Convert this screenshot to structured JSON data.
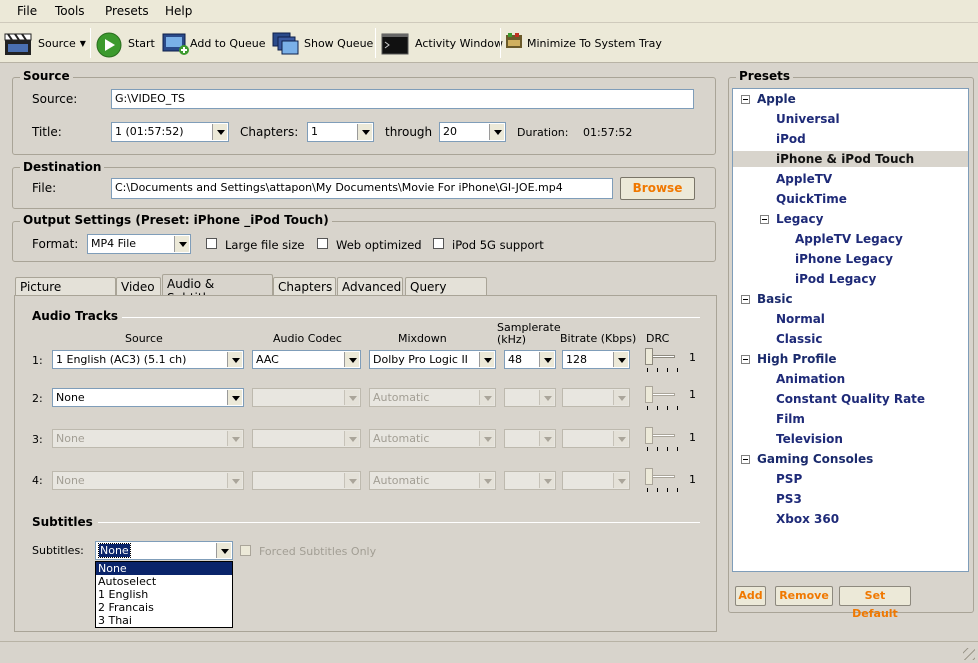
{
  "menu": {
    "file": "File",
    "tools": "Tools",
    "presets": "Presets",
    "help": "Help"
  },
  "toolbar": {
    "source": "Source",
    "start": "Start",
    "add_to_queue": "Add to Queue",
    "show_queue": "Show Queue",
    "activity_window": "Activity Window",
    "minimize": "Minimize To System Tray"
  },
  "source": {
    "group_title": "Source",
    "source_label": "Source:",
    "source_value": "G:\\VIDEO_TS",
    "title_label": "Title:",
    "title_value": "1 (01:57:52)",
    "chapters_label": "Chapters:",
    "chapters_from": "1",
    "through_label": "through",
    "chapters_to": "20",
    "duration_label": "Duration:",
    "duration_value": "01:57:52"
  },
  "destination": {
    "group_title": "Destination",
    "file_label": "File:",
    "file_value": "C:\\Documents and Settings\\attapon\\My Documents\\Movie For iPhone\\GI-JOE.mp4",
    "browse": "Browse"
  },
  "output": {
    "group_title": "Output Settings (Preset: iPhone _iPod Touch)",
    "format_label": "Format:",
    "format_value": "MP4 File",
    "large_file": "Large file size",
    "web_optimized": "Web optimized",
    "ipod5g": "iPod 5G support"
  },
  "tabs": [
    "Picture Settings",
    "Video",
    "Audio & Subtitles",
    "Chapters",
    "Advanced",
    "Query Editor"
  ],
  "audio": {
    "section_title": "Audio Tracks",
    "headers": {
      "source": "Source",
      "codec": "Audio Codec",
      "mixdown": "Mixdown",
      "samplerate_1": "Samplerate",
      "samplerate_2": "(kHz)",
      "bitrate": "Bitrate (Kbps)",
      "drc": "DRC"
    },
    "tracks": [
      {
        "num": "1:",
        "source": "1 English (AC3) (5.1 ch)",
        "codec": "AAC",
        "mixdown": "Dolby Pro Logic II",
        "samplerate": "48",
        "bitrate": "128",
        "drc": "1"
      },
      {
        "num": "2:",
        "source": "None",
        "codec": "",
        "mixdown": "Automatic",
        "samplerate": "",
        "bitrate": "",
        "drc": "1"
      },
      {
        "num": "3:",
        "source": "None",
        "codec": "",
        "mixdown": "Automatic",
        "samplerate": "",
        "bitrate": "",
        "drc": "1"
      },
      {
        "num": "4:",
        "source": "None",
        "codec": "",
        "mixdown": "Automatic",
        "samplerate": "",
        "bitrate": "",
        "drc": "1"
      }
    ]
  },
  "subtitles": {
    "section_title": "Subtitles",
    "label": "Subtitles:",
    "value": "None",
    "forced": "Forced Subtitles Only",
    "options": [
      "None",
      "Autoselect",
      "1 English",
      "2 Francais",
      "3 Thai"
    ]
  },
  "presets": {
    "title": "Presets",
    "items": [
      {
        "label": "Apple"
      },
      {
        "label": "Universal"
      },
      {
        "label": "iPod"
      },
      {
        "label": "iPhone & iPod Touch"
      },
      {
        "label": "AppleTV"
      },
      {
        "label": "QuickTime"
      },
      {
        "label": "Legacy"
      },
      {
        "label": "AppleTV Legacy"
      },
      {
        "label": "iPhone Legacy"
      },
      {
        "label": "iPod Legacy"
      },
      {
        "label": "Basic"
      },
      {
        "label": "Normal"
      },
      {
        "label": "Classic"
      },
      {
        "label": "High Profile"
      },
      {
        "label": "Animation"
      },
      {
        "label": "Constant Quality Rate"
      },
      {
        "label": "Film"
      },
      {
        "label": "Television"
      },
      {
        "label": "Gaming Consoles"
      },
      {
        "label": "PSP"
      },
      {
        "label": "PS3"
      },
      {
        "label": "Xbox 360"
      }
    ],
    "add": "Add",
    "remove": "Remove",
    "set_default": "Set Default"
  }
}
